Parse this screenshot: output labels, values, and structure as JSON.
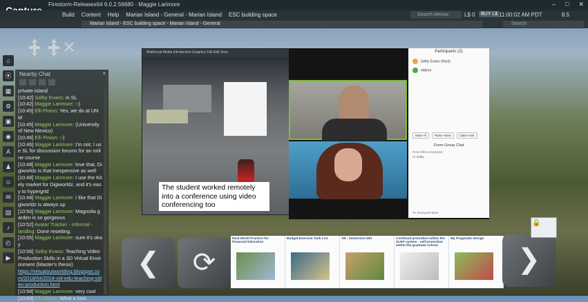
{
  "app": {
    "title": "Firestorm-Releasex64 6.0.2.56680 - Maggie Larimore",
    "capture_label": "Capture",
    "menus": [
      "Build",
      "Content",
      "Help",
      "Marian Island - General - Marian Island",
      "ESC building space"
    ],
    "search_menus_placeholder": "Search Menus",
    "balance": "L$ 0",
    "buy_label": "BUY L$",
    "clock": "11:00:02 AM PDT",
    "fps": "8.5",
    "location": "Marian Island - ESC building space - Marian Island - General",
    "search_placeholder": "Search"
  },
  "chat": {
    "title": "Nearby Chat",
    "close": "×",
    "lines": [
      {
        "ts": "",
        "name": "",
        "text": "private island"
      },
      {
        "ts": "[10:42]",
        "name": "Selby Evans:",
        "text": " in SL"
      },
      {
        "ts": "[10:42]",
        "name": "Maggie Larimore:",
        "text": " :-)"
      },
      {
        "ts": "[10:45]",
        "name": "Elli Pinion:",
        "text": " Yes, we do at UNM"
      },
      {
        "ts": "[10:45]",
        "name": "Maggie Larimore:",
        "text": " (University of New Mexico)"
      },
      {
        "ts": "[10:46]",
        "name": "Elli Pinion:",
        "text": " :-)"
      },
      {
        "ts": "[10:46]",
        "name": "Maggie Larimore:",
        "text": " I'm not; I use SL for discussion forums for an online course"
      },
      {
        "ts": "[10:48]",
        "name": "Maggie Larimore:",
        "text": " love that, Digiworldz is that inexpensive as well"
      },
      {
        "ts": "[10:48]",
        "name": "Maggie Larimore:",
        "text": " I use the Kitely market for Digiworldz, and it's easy to hypergrid"
      },
      {
        "ts": "[10:48]",
        "name": "Maggie Larimore:",
        "text": " I like that Digiworldz is always up"
      },
      {
        "ts": "[10:50]",
        "name": "Maggie Larimore:",
        "text": " Magnolia garden is so gorgeous"
      },
      {
        "ts": "[10:52]",
        "name": "Avatar Tracker - informal - landing:",
        "text": " Done resetting."
      },
      {
        "ts": "[10:55]",
        "name": "Maggie Larimore:",
        "text": " sure it's okay"
      },
      {
        "ts": "[10:56]",
        "name": "Selby Evans:",
        "text": " Teaching Video Production Skills in a 3D Virtual Environment (Master's thesis)"
      },
      {
        "ts": "",
        "name": "",
        "text": "https://virtualoutworlding.blogspot.com/2018/04/2018-vid-edu-teaching-video-production.html",
        "link": true
      },
      {
        "ts": "[10:58]",
        "name": "Maggie Larimore:",
        "text": " very cool"
      },
      {
        "ts": "[10:59]",
        "name": "Elli Pinion:",
        "text": " What a loss."
      }
    ]
  },
  "screen": {
    "menu": "Multivocal  Media   Introduction   Graphics   File   Edit   View",
    "caption": "The student worked remotely into a conference using video conferencing too"
  },
  "participants": {
    "title": "Participants (2)",
    "people": [
      {
        "name": "Selby Evans (Host)",
        "color": "#f2a541"
      },
      {
        "name": "elderm",
        "color": "#59a14f"
      }
    ],
    "buttons": [
      "Mute All",
      "Raise Hand",
      "Claim Host"
    ],
    "chat_title": "Zoom Group Chat",
    "chat_line1": "From Elli to Everyone:",
    "chat_line2": "Hi Selby",
    "footer": "To:  Everyone          More"
  },
  "slides": [
    {
      "title": "Real World Practice for Financial Education"
    },
    {
      "title": "Budget Exercise Task List"
    },
    {
      "title": "VR - immersive DEI"
    },
    {
      "title": "Continual promotion within the SLRP system - self promotion within the graduate school"
    },
    {
      "title": "My Pragmatic Design"
    }
  ],
  "glyphs": {
    "prev": "❮",
    "reload": "⟳",
    "next": "❯"
  }
}
